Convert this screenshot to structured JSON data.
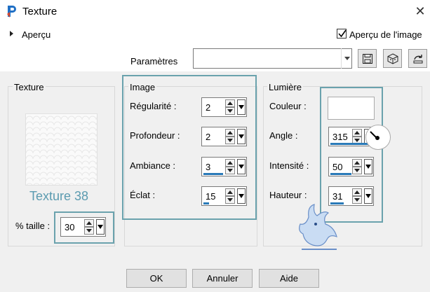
{
  "window": {
    "title": "Texture",
    "close_glyph": "✕"
  },
  "top": {
    "apercu": "Aperçu",
    "apercu_checkbox": "Aperçu de l'image",
    "apercu_checked": true,
    "parametres_label": "Paramètres",
    "parametres_value": ""
  },
  "texture": {
    "group": "Texture",
    "name": "Texture 38",
    "taille_label": "% taille :",
    "taille": "30"
  },
  "image": {
    "group": "Image",
    "regularite_label": "Régularité :",
    "regularite": "2",
    "profondeur_label": "Profondeur :",
    "profondeur": "2",
    "ambiance_label": "Ambiance :",
    "ambiance": "3",
    "eclat_label": "Éclat :",
    "eclat": "15"
  },
  "lumiere": {
    "group": "Lumière",
    "couleur_label": "Couleur :",
    "couleur_value": "#ffffff",
    "angle_label": "Angle :",
    "angle": "315",
    "intensite_label": "Intensité :",
    "intensite": "50",
    "hauteur_label": "Hauteur :",
    "hauteur": "31"
  },
  "buttons": {
    "ok": "OK",
    "annuler": "Annuler",
    "aide": "Aide"
  },
  "colors": {
    "highlight": "#6aa2ad",
    "texture_name": "#5b9bb0",
    "progress": "#2a7ab8"
  }
}
